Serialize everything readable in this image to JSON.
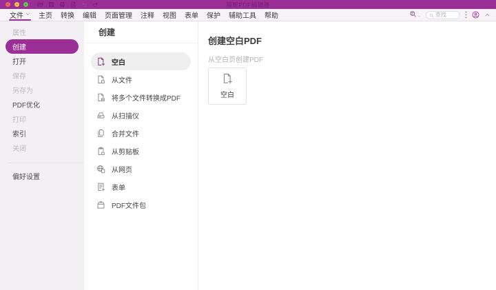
{
  "window": {
    "title": "福昕PDF编辑器",
    "traffic_lights": [
      "close",
      "minimize",
      "zoom"
    ],
    "quick_icons": [
      {
        "icon": "open-folder-icon",
        "state": "normal"
      },
      {
        "icon": "save-icon",
        "state": "normal"
      },
      {
        "icon": "print-icon",
        "state": "normal"
      },
      {
        "icon": "new-document-icon",
        "state": "normal"
      },
      {
        "icon": "undo-icon",
        "state": "disabled"
      },
      {
        "icon": "redo-icon",
        "state": "normal"
      }
    ]
  },
  "menubar": {
    "items": [
      {
        "label": "文件",
        "has_dropdown": true,
        "active": true
      },
      {
        "label": "主页"
      },
      {
        "label": "转换"
      },
      {
        "label": "编辑"
      },
      {
        "label": "页面管理"
      },
      {
        "label": "注释"
      },
      {
        "label": "视图"
      },
      {
        "label": "表单"
      },
      {
        "label": "保护"
      },
      {
        "label": "辅助工具"
      },
      {
        "label": "帮助"
      }
    ],
    "search_placeholder": "查找"
  },
  "sidebar": {
    "items": [
      {
        "label": "属性",
        "state": "disabled"
      },
      {
        "label": "创建",
        "state": "selected"
      },
      {
        "label": "打开",
        "state": "normal"
      },
      {
        "label": "保存",
        "state": "disabled"
      },
      {
        "label": "另存为",
        "state": "disabled"
      },
      {
        "label": "PDF优化",
        "state": "normal"
      },
      {
        "label": "打印",
        "state": "disabled"
      },
      {
        "label": "索引",
        "state": "normal"
      },
      {
        "label": "关闭",
        "state": "disabled"
      }
    ],
    "footer_item": {
      "label": "偏好设置",
      "state": "normal"
    }
  },
  "middle": {
    "header": "创建",
    "items": [
      {
        "label": "空白",
        "icon": "blank-doc-plus-icon",
        "selected": true
      },
      {
        "label": "从文件",
        "icon": "doc-from-file-icon"
      },
      {
        "label": "将多个文件转换成PDF",
        "icon": "multi-file-convert-icon"
      },
      {
        "label": "从扫描仪",
        "icon": "scanner-icon"
      },
      {
        "label": "合并文件",
        "icon": "combine-files-icon"
      },
      {
        "label": "从剪贴板",
        "icon": "clipboard-icon"
      },
      {
        "label": "从网页",
        "icon": "web-page-icon"
      },
      {
        "label": "表单",
        "icon": "form-icon"
      },
      {
        "label": "PDF文件包",
        "icon": "pdf-portfolio-icon"
      }
    ]
  },
  "content": {
    "title": "创建空白PDF",
    "subtitle": "从空白页创建PDF",
    "card": {
      "label": "空白",
      "icon": "blank-doc-plus-icon"
    }
  },
  "colors": {
    "titlebar": "#9a2d96",
    "accent": "#9b2f97",
    "close_button": "#ee6a5e",
    "minimize_button": "#f5c04f",
    "zoom_button": "#63c74f"
  }
}
